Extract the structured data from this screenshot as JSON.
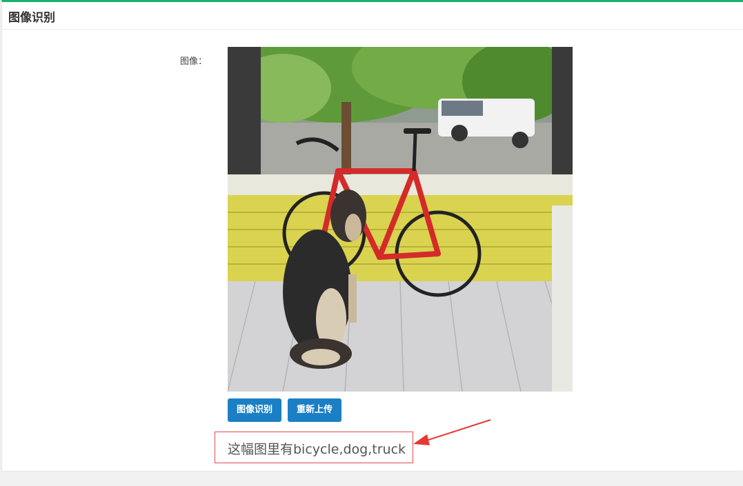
{
  "panel": {
    "title": "图像识别",
    "accent_color": "#1ab16a"
  },
  "form": {
    "image_label": "图像："
  },
  "buttons": {
    "recognize_label": "图像识别",
    "reupload_label": "重新上传",
    "button_color": "#1b7fc6"
  },
  "result": {
    "text": "这幅图里有bicycle,dog,truck",
    "border_color": "#e04a4a"
  },
  "annotation": {
    "arrow_color": "#e53935",
    "icon": "red-arrow-pointer"
  }
}
